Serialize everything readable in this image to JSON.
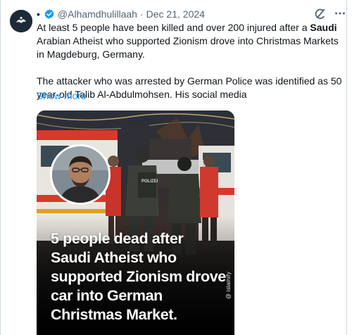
{
  "author": {
    "handle": "@Alhamdhulillaah",
    "separator": "·",
    "date": "Dec 21, 2024",
    "lead_dot": "•",
    "verified": true
  },
  "icons": {
    "avatar": "avatar-logo",
    "verified": "verified-badge-icon",
    "grok": "grok-icon",
    "more": "more-options-icon"
  },
  "tweet": {
    "line_a": "At least 5 people have been killed and over 200 injured after a ",
    "bold": "Saudi",
    "line_b": " Arabian Atheist who supported Zionism drove into Christmas Markets in Magdeburg, Germany.",
    "para2": "The attacker who was arrested by German Police was identified as 50 year-old Talib Al-Abdulmohsen. His social media",
    "show_more": "Show more"
  },
  "media": {
    "headline": "5 people dead after Saudi Atheist who supported Zionism drove car into German Christmas Market.",
    "watermark": "@ islamify",
    "police_label": "POLIZEI"
  },
  "colors": {
    "link": "#1d9bf0",
    "verified": "#1d9bf0",
    "muted": "#536471",
    "text": "#0f1419"
  }
}
